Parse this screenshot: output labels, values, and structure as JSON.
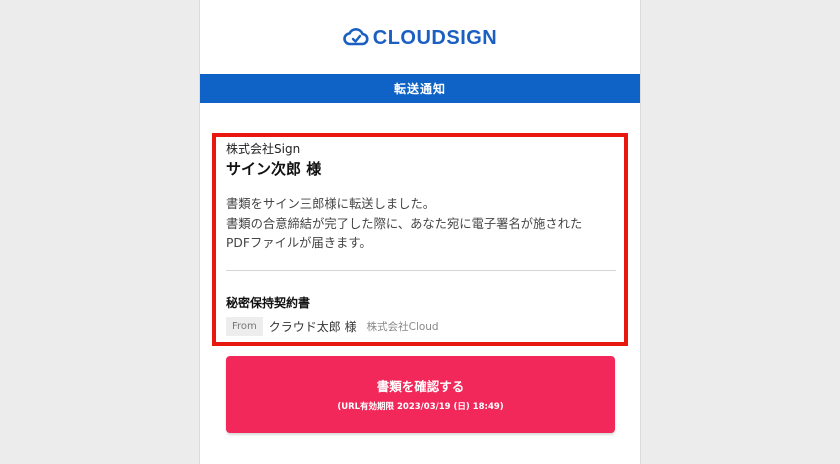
{
  "logo": {
    "text": "CLOUDSIGN",
    "icon": "cloud-sign-icon",
    "color": "#1c5fc2"
  },
  "banner": {
    "title": "転送通知",
    "color": "#0f63c7"
  },
  "card": {
    "company": "株式会社Sign",
    "recipient": "サイン次郎 様",
    "message_lines": [
      "書類をサイン三郎様に転送しました。",
      "書類の合意締結が完了した際に、あなた宛に電子署名が施された",
      "PDFファイルが届きます。"
    ],
    "document_title": "秘密保持契約書",
    "from_label": "From",
    "sender_name": "クラウド太郎 様",
    "sender_company": "株式会社Cloud",
    "highlight_color": "#e8170f"
  },
  "button": {
    "label": "書類を確認する",
    "expiry": "(URL有効期限 2023/03/19 (日) 18:49)",
    "color": "#f2285a"
  }
}
